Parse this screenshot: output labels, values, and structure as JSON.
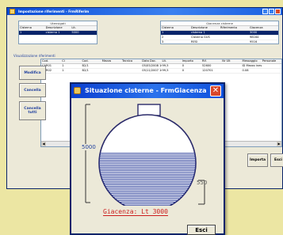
{
  "bg_window": {
    "title": "Impostazione riferimenti - FrmRiferim",
    "tank_list_caption": "Utensigati",
    "tank_list_headers": [
      "Cisterna",
      "Descrizione",
      "Lit."
    ],
    "tank_list_rows": [
      [
        "1",
        "cisterna 1",
        "5000"
      ]
    ],
    "stock_caption": "Giacenza cisterne",
    "stock_headers": [
      "Cisterna",
      "Descrizione",
      "Riferimento",
      "Giacenza"
    ],
    "stock_rows": [
      [
        "1",
        "cisterna 1",
        "",
        "3000"
      ],
      [
        "2",
        "Cisterna GUS",
        "",
        "98164"
      ],
      [
        "3",
        "RESI",
        "",
        "9516"
      ]
    ],
    "section_title": "Visualizzazione riferimenti",
    "ref_headers": [
      "Cod.",
      "Ci",
      "Cod.",
      "Mezzo",
      "Tecnico",
      "Data Doc.",
      "Lit.",
      "Importo",
      "Rif.",
      "Nr Ult",
      "Messaggio",
      "Personale"
    ],
    "ref_rows": [
      [
        "CAR01",
        "1",
        "B2/1",
        "",
        "",
        "05/05/2008 10:00",
        "99,5",
        "0",
        "52600",
        "",
        "ID Mezzo inesistente",
        ""
      ],
      [
        "CAR02",
        "1",
        "B2/1",
        "",
        "",
        "05/11/2007 10:00",
        "99,5",
        "0",
        "120701",
        "",
        "0.08",
        ""
      ]
    ],
    "buttons": {
      "modifica": "Modifica",
      "cancella": "Cancella",
      "cancella_tutti": "Cancella tutti",
      "importa": "Importa",
      "esci": "Esci"
    }
  },
  "dialog": {
    "title": "Situazione cisterne - FrmGiacenza",
    "capacity_label": "5000",
    "level_label": "550",
    "giacenza_label": "Giacenza: Lt 3000",
    "esci_label": "Esci",
    "fill_fraction": 0.6
  },
  "colors": {
    "desktop": "#ece6a3",
    "title_bar": "#0a3fd0",
    "tank_outline": "#2a2a6a",
    "liquid": "#2a3d9a",
    "giacenza_text": "#cc1f1f"
  }
}
